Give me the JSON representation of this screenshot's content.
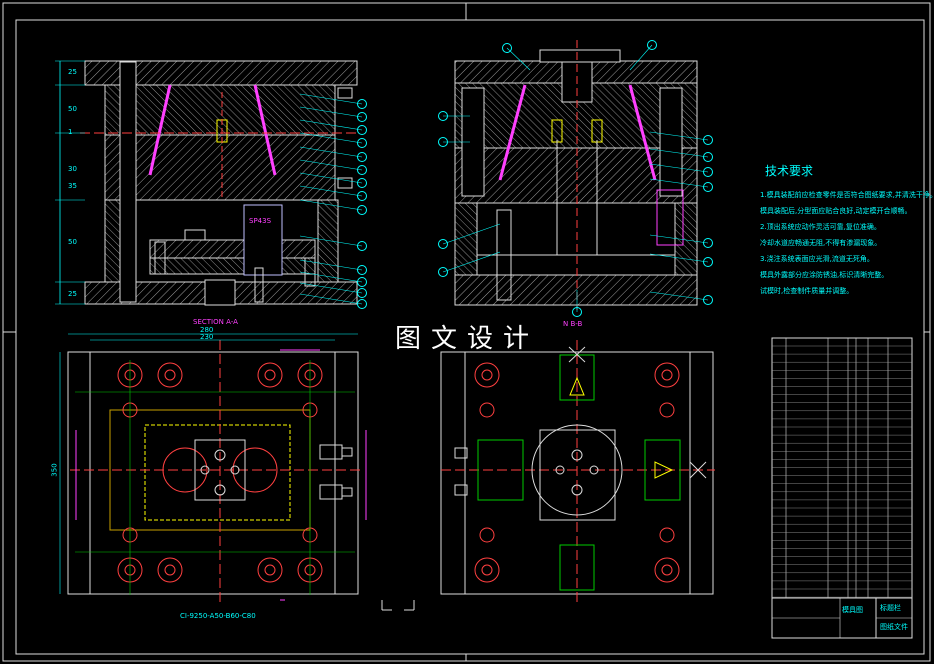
{
  "overlay_title": "图文设计",
  "requirements": {
    "title": "技术要求",
    "lines": [
      "1.模具装配前应检查零件是否符合图纸要求,并清洗干净。",
      "模具装配后,分型面应贴合良好,动定模开合顺畅。",
      "2.顶出系统应动作灵活可靠,复位准确。",
      "冷却水道应畅通无阻,不得有渗漏现象。",
      "3.浇注系统表面应光滑,流道无死角。",
      "模具外露部分应涂防锈油,标识清晰完整。",
      "试模时,检查制件质量并调整。"
    ]
  },
  "views": {
    "section_label": "SECTION A-A",
    "view_b_label": "N B-B",
    "part_label": "SP43S",
    "bottom_code": "CI-9250-A50-B60-C80"
  },
  "dims": {
    "top_width_1": "280",
    "top_width_2": "230",
    "height": "350",
    "left_dims": [
      "25",
      "50",
      "1",
      "30",
      "35",
      "50",
      "25"
    ]
  },
  "title_block": {
    "name": "模具图",
    "school": "图纸文件",
    "company": "标题栏"
  },
  "balloon_count_left": 14,
  "balloon_count_right": 16
}
